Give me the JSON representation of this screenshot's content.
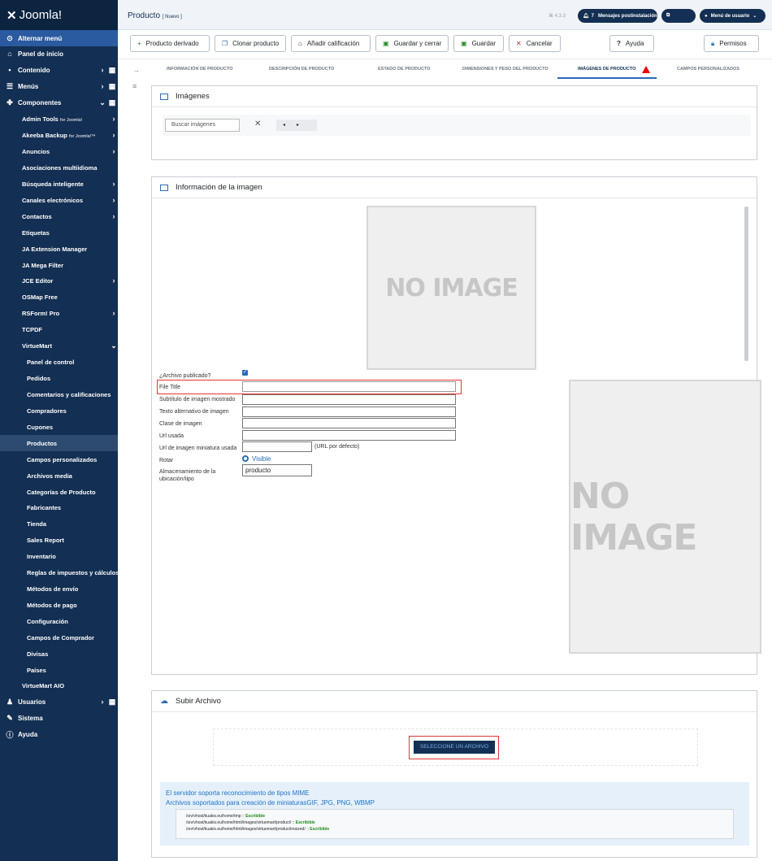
{
  "brand": {
    "logo_text": "Joomla!"
  },
  "sidebar": {
    "toggle": "Alternar menú",
    "items": [
      {
        "label": "Panel de inicio"
      },
      {
        "label": "Contenido"
      },
      {
        "label": "Menús"
      },
      {
        "label": "Componentes"
      },
      {
        "label": "Admin Tools",
        "small": "for Joomla!"
      },
      {
        "label": "Akeeba Backup",
        "small": "for Joomla!™"
      },
      {
        "label": "Anuncios"
      },
      {
        "label": "Asociaciones multiidioma"
      },
      {
        "label": "Búsqueda inteligente"
      },
      {
        "label": "Canales electrónicos"
      },
      {
        "label": "Contactos"
      },
      {
        "label": "Etiquetas"
      },
      {
        "label": "JA Extension Manager"
      },
      {
        "label": "JA Mega Filter"
      },
      {
        "label": "JCE Editor"
      },
      {
        "label": "OSMap Free"
      },
      {
        "label": "RSForm! Pro"
      },
      {
        "label": "TCPDF"
      },
      {
        "label": "VirtueMart"
      },
      {
        "label": "Panel de control"
      },
      {
        "label": "Pedidos"
      },
      {
        "label": "Comentarios y calificaciones"
      },
      {
        "label": "Compradores"
      },
      {
        "label": "Cupones"
      },
      {
        "label": "Productos"
      },
      {
        "label": "Campos personalizados"
      },
      {
        "label": "Archivos media"
      },
      {
        "label": "Categorías de Producto"
      },
      {
        "label": "Fabricantes"
      },
      {
        "label": "Tienda"
      },
      {
        "label": "Sales Report"
      },
      {
        "label": "Inventario"
      },
      {
        "label": "Reglas de impuestos y cálculos"
      },
      {
        "label": "Métodos de envío"
      },
      {
        "label": "Métodos de pago"
      },
      {
        "label": "Configuración"
      },
      {
        "label": "Campos de Comprador"
      },
      {
        "label": "Divisas"
      },
      {
        "label": "Países"
      },
      {
        "label": "VirtueMart AIO"
      },
      {
        "label": "Usuarios"
      },
      {
        "label": "Sistema"
      },
      {
        "label": "Ayuda"
      }
    ]
  },
  "header": {
    "title": "Producto",
    "subtitle": "[ Nuevo ]",
    "version": "4.3.3",
    "notifications_count": "7",
    "notifications_label": "Mensajes postinstalación",
    "user_menu": "Menú de usuario"
  },
  "toolbar": {
    "derived": "Producto derivado",
    "clone": "Clonar producto",
    "rating": "Añadir calificación",
    "save_close": "Guardar y cerrar",
    "save": "Guardar",
    "cancel": "Cancelar",
    "help": "Ayuda",
    "permissions": "Permisos"
  },
  "tabs": [
    "INFORMACIÓN DE PRODUCTO",
    "DESCRIPCIÓN DE PRODUCTO",
    "ESTADO DE PRODUCTO",
    "DIMENSIONES Y PESO DEL PRODUCTO",
    "IMÁGENES DE PRODUCTO",
    "CAMPOS PERSONALIZADOS"
  ],
  "images_card": {
    "title": "Imágenes",
    "search_placeholder": "Buscar imágenes"
  },
  "info_card": {
    "title": "Información de la imagen",
    "no_image": "NO IMAGE",
    "fields": {
      "published": "¿Archivo publicado?",
      "file_title": "File Title",
      "subtitle": "Subtítulo de imagen mostrado",
      "alt": "Texto alternativo de imagen",
      "class": "Clase de imagen",
      "url": "Url usada",
      "thumb_url": "Url de imagen miniatura usada",
      "thumb_note": "(URL por defecto)",
      "rotate": "Rotar",
      "rotate_value": "Visible",
      "storage": "Almacenamiento de la ubicación/tipo",
      "storage_value": "producto"
    }
  },
  "upload_card": {
    "title": "Subir Archivo",
    "button": "SELECCIONE UN ARCHIVO",
    "mime_msg": "El servidor soporta reconocimiento de tipos MIME",
    "thumb_msg": "Archivos soportados para creación de miniaturasGIF, JPG, PNG, WBMP",
    "paths": [
      {
        "path": "/srv/vhost/kuakis.eu/home/tmp :: ",
        "status": "Escribible"
      },
      {
        "path": "/srv/vhost/kuakis.eu/home/html/images/virtuemart/product/ :: ",
        "status": "Escribible"
      },
      {
        "path": "/srv/vhost/kuakis.eu/home/html/images/virtuemart/product/resized/ :: ",
        "status": "Escribible"
      }
    ]
  },
  "colors": {
    "sidebar": "#132f53",
    "accent": "#2a69b8",
    "highlight": "#e53535",
    "writable": "#1a8a1a"
  }
}
